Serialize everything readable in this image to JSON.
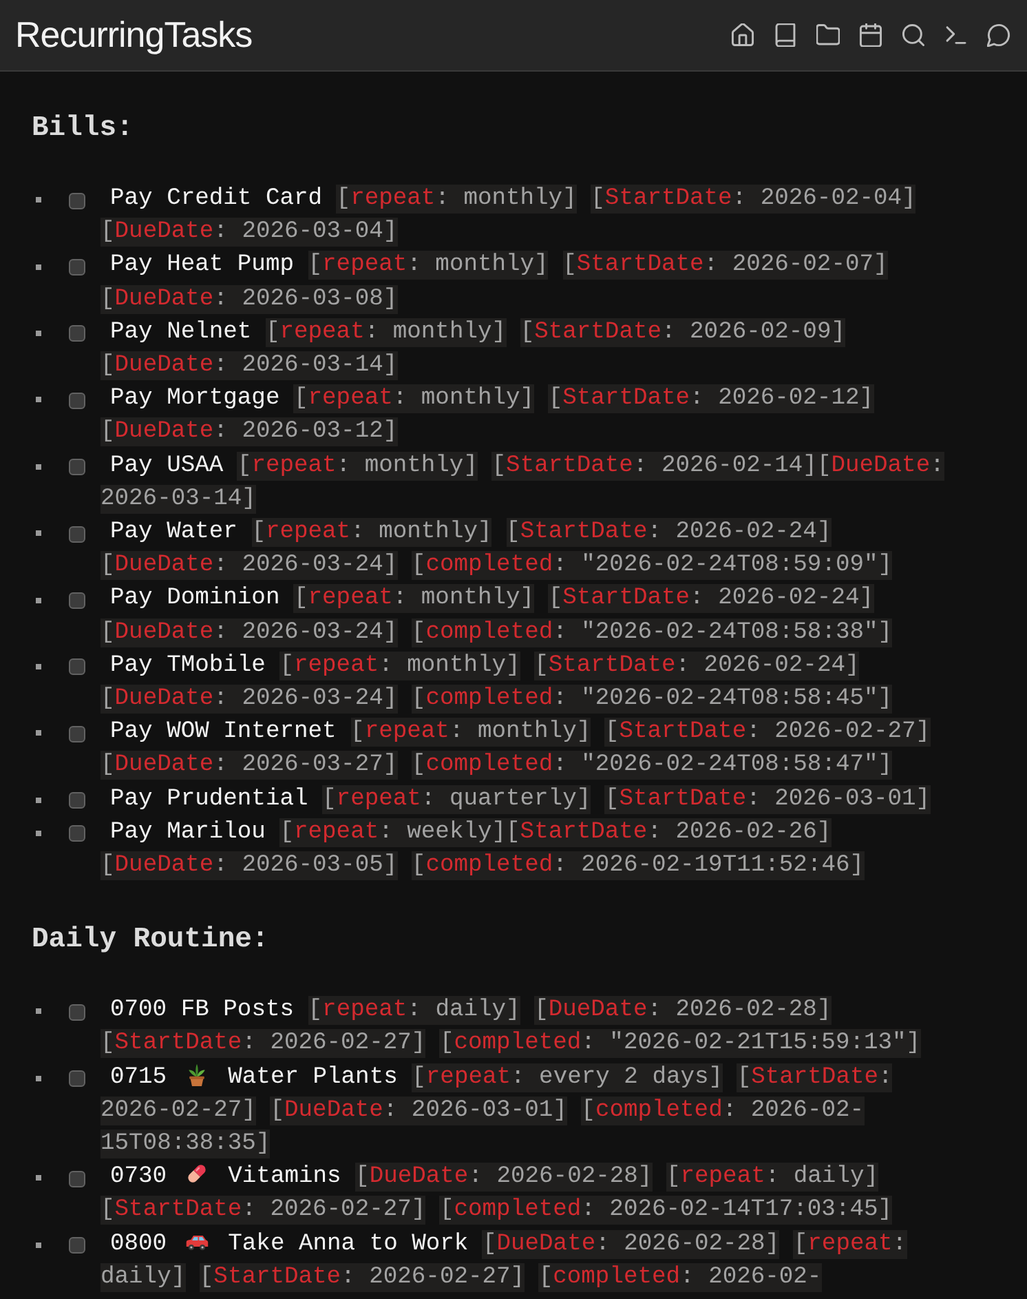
{
  "header": {
    "title": "RecurringTasks"
  },
  "sections": [
    {
      "heading": "Bills:",
      "tasks": [
        {
          "checked": false,
          "kind": "plain",
          "text": "Pay Credit Card [repeat: monthly] [StartDate: 2026-02-04] [DueDate: 2026-03-04]"
        },
        {
          "checked": false,
          "kind": "plain",
          "text": "Pay Heat Pump [repeat: monthly] [StartDate: 2026-02-07] [DueDate: 2026-03-08]"
        },
        {
          "checked": false,
          "kind": "plain",
          "text": "Pay Nelnet [repeat: monthly] [StartDate: 2026-02-09] [DueDate: 2026-03-14]"
        },
        {
          "checked": false,
          "kind": "plain",
          "text": "Pay Mortgage [repeat: monthly] [StartDate: 2026-02-12] [DueDate: 2026-03-12]"
        },
        {
          "checked": false,
          "kind": "plain",
          "text": "Pay USAA [repeat: monthly] [StartDate: 2026-02-14][DueDate: 2026-03-14]"
        },
        {
          "checked": false,
          "kind": "plain",
          "text": "Pay Water [repeat: monthly] [StartDate: 2026-02-24] [DueDate: 2026-03-24] [completed: \"2026-02-24T08:59:09\"]"
        },
        {
          "checked": false,
          "kind": "plain",
          "text": "Pay Dominion [repeat: monthly] [StartDate: 2026-02-24] [DueDate: 2026-03-24] [completed: \"2026-02-24T08:58:38\"]"
        },
        {
          "checked": false,
          "kind": "plain",
          "text": "Pay TMobile [repeat: monthly] [StartDate: 2026-02-24] [DueDate: 2026-03-24] [completed: \"2026-02-24T08:58:45\"]"
        },
        {
          "checked": false,
          "kind": "plain",
          "text": "Pay WOW Internet [repeat: monthly] [StartDate: 2026-02-27] [DueDate: 2026-03-27] [completed: \"2026-02-24T08:58:47\"]"
        },
        {
          "checked": false,
          "kind": "plain",
          "text": "Pay Prudential [repeat: quarterly] [StartDate: 2026-03-01]"
        },
        {
          "checked": false,
          "kind": "plain",
          "text": "Pay Marilou [repeat: weekly][StartDate: 2026-02-26] [DueDate: 2026-03-05] [completed: 2026-02-19T11:52:46]"
        }
      ]
    },
    {
      "heading": "Daily Routine:",
      "tasks": [
        {
          "checked": false,
          "kind": "plain",
          "time": "0700",
          "text": "FB Posts [repeat: daily] [DueDate: 2026-02-28] [StartDate: 2026-02-27] [completed: \"2026-02-21T15:59:13\"]"
        },
        {
          "checked": false,
          "kind": "plant",
          "time": "0715",
          "text": "Water Plants [repeat: every 2 days] [StartDate: 2026-02-27] [DueDate: 2026-03-01] [completed: 2026-02-15T08:38:35]"
        },
        {
          "checked": false,
          "kind": "pill",
          "time": "0730",
          "text": "Vitamins [DueDate: 2026-02-28] [repeat: daily] [StartDate: 2026-02-27] [completed: 2026-02-14T17:03:45]"
        },
        {
          "checked": false,
          "kind": "car",
          "time": "0800",
          "text": "Take Anna to Work [DueDate: 2026-02-28] [repeat: daily] [StartDate: 2026-02-27] [completed: 2026-02-"
        }
      ]
    }
  ]
}
